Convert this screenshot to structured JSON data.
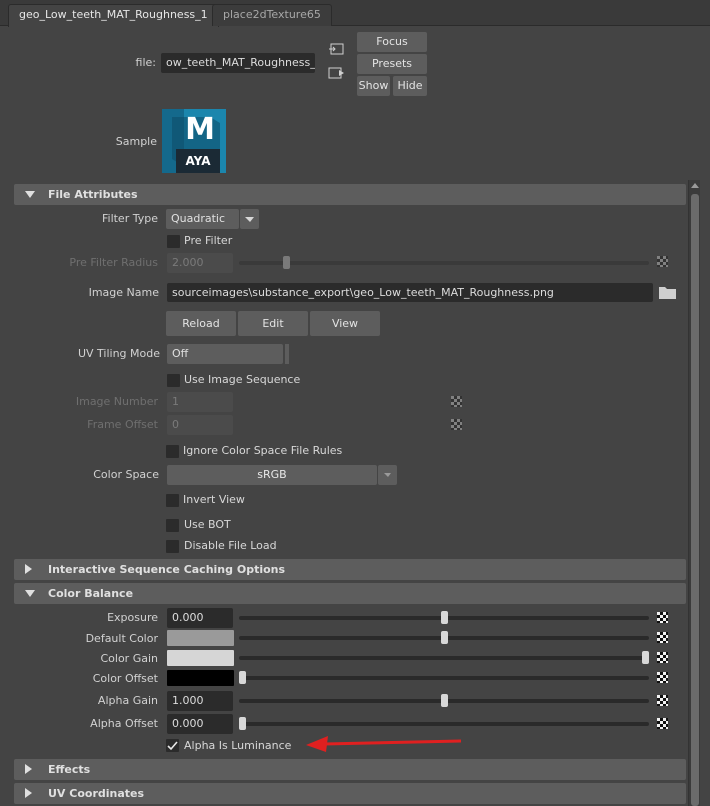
{
  "tabs": [
    "geo_Low_teeth_MAT_Roughness_1",
    "place2dTexture65"
  ],
  "header": {
    "file_label": "file:",
    "file_value": "ow_teeth_MAT_Roughness_1",
    "focus": "Focus",
    "presets": "Presets",
    "show": "Show",
    "hide": "Hide",
    "sample_label": "Sample",
    "logo_letter": "M",
    "logo_text": "AYA"
  },
  "file_attributes": {
    "title": "File Attributes",
    "filter_type_label": "Filter Type",
    "filter_type_value": "Quadratic",
    "pre_filter": "Pre Filter",
    "pre_filter_radius_label": "Pre Filter Radius",
    "pre_filter_radius_value": "2.000",
    "image_name_label": "Image Name",
    "image_name_value": "sourceimages\\substance_export\\geo_Low_teeth_MAT_Roughness.png",
    "reload": "Reload",
    "edit": "Edit",
    "view": "View",
    "uv_tiling_label": "UV Tiling Mode",
    "uv_tiling_value": "Off",
    "use_image_sequence": "Use Image Sequence",
    "image_number_label": "Image Number",
    "image_number_value": "1",
    "frame_offset_label": "Frame Offset",
    "frame_offset_value": "0",
    "ignore_color_space": "Ignore Color Space File Rules",
    "color_space_label": "Color Space",
    "color_space_value": "sRGB",
    "invert_view": "Invert View",
    "use_bot": "Use BOT",
    "disable_file_load": "Disable File Load"
  },
  "interactive_caching": {
    "title": "Interactive Sequence Caching Options"
  },
  "color_balance": {
    "title": "Color Balance",
    "exposure_label": "Exposure",
    "exposure_value": "0.000",
    "exposure_level": 0.5,
    "default_color_label": "Default Color",
    "default_color": "#9a9a9a",
    "default_color_level": 0.5,
    "color_gain_label": "Color Gain",
    "color_gain": "#d6d6d6",
    "color_gain_level": 1.0,
    "color_offset_label": "Color Offset",
    "color_offset": "#000000",
    "color_offset_level": 0.0,
    "alpha_gain_label": "Alpha Gain",
    "alpha_gain_value": "1.000",
    "alpha_gain_level": 0.5,
    "alpha_offset_label": "Alpha Offset",
    "alpha_offset_value": "0.000",
    "alpha_offset_level": 0.0,
    "alpha_is_luminance": "Alpha Is Luminance",
    "alpha_is_luminance_checked": true
  },
  "effects": {
    "title": "Effects"
  },
  "uv_coordinates": {
    "title": "UV Coordinates"
  },
  "annotation_color": "#e02020"
}
